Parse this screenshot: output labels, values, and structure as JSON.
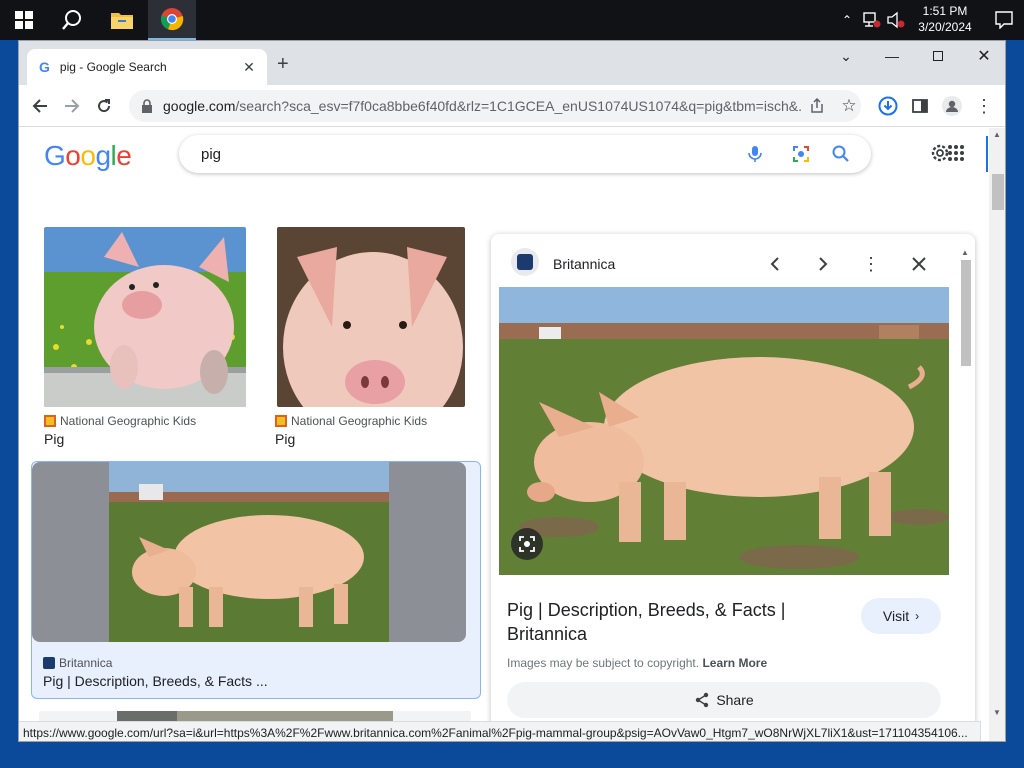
{
  "taskbar": {
    "time": "1:51 PM",
    "date": "3/20/2024"
  },
  "browser": {
    "tab_title": "pig - Google Search",
    "url_host": "google.com",
    "url_rest": "/search?sca_esv=f7f0ca8bbe6f40fd&rlz=1C1GCEA_enUS1074US1074&q=pig&tbm=isch&..."
  },
  "google": {
    "logo": "Google",
    "query": "pig"
  },
  "results": [
    {
      "source": "National Geographic Kids",
      "title": "Pig"
    },
    {
      "source": "National Geographic Kids",
      "title": "Pig"
    },
    {
      "source": "Britannica",
      "title": "Pig | Description, Breeds, & Facts ..."
    }
  ],
  "panel": {
    "source": "Britannica",
    "title": "Pig | Description, Breeds, & Facts | Britannica",
    "visit_label": "Visit",
    "copyright_text": "Images may be subject to copyright.",
    "learn_more": "Learn More",
    "share_label": "Share"
  },
  "status_url": "https://www.google.com/url?sa=i&url=https%3A%2F%2Fwww.britannica.com%2Fanimal%2Fpig-mammal-group&psig=AOvVaw0_Htgm7_wO8NrWjXL7liX1&ust=171104354106..."
}
